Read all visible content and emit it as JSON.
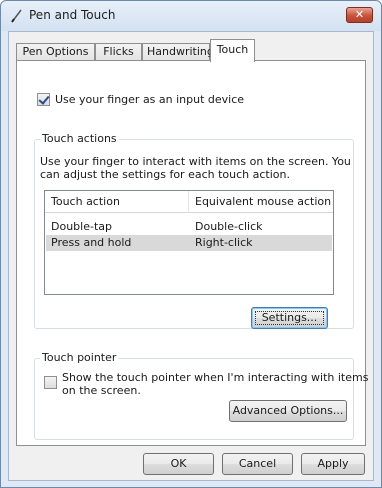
{
  "window": {
    "title": "Pen and Touch",
    "close_label": "✕"
  },
  "tabs": [
    {
      "label": "Pen Options"
    },
    {
      "label": "Flicks"
    },
    {
      "label": "Handwriting"
    },
    {
      "label": "Touch"
    }
  ],
  "active_tab": "Touch",
  "use_finger": {
    "label": "Use your finger as an input device",
    "checked": true
  },
  "touch_actions": {
    "group_title": "Touch actions",
    "description": "Use your finger to interact with items on the screen. You can adjust the settings for each touch action.",
    "description_line1": "Use your finger to interact with items on the screen. You",
    "description_line2": "can adjust the settings for each touch action.",
    "columns": [
      "Touch action",
      "Equivalent mouse action"
    ],
    "rows": [
      {
        "action": "Double-tap",
        "mouse": "Double-click",
        "selected": false
      },
      {
        "action": "Press and hold",
        "mouse": "Right-click",
        "selected": true
      }
    ],
    "settings_button": "Settings..."
  },
  "touch_pointer": {
    "group_title": "Touch pointer",
    "checkbox_label_line1": "Show the touch pointer when I'm interacting with items",
    "checkbox_label_line2": "on the screen.",
    "checked": false,
    "advanced_button": "Advanced Options..."
  },
  "footer": {
    "ok": "OK",
    "cancel": "Cancel",
    "apply": "Apply"
  },
  "colors": {
    "frame": "#dfe9f5",
    "close_button": "#c6533c",
    "selected_row": "#d9d9d9"
  }
}
